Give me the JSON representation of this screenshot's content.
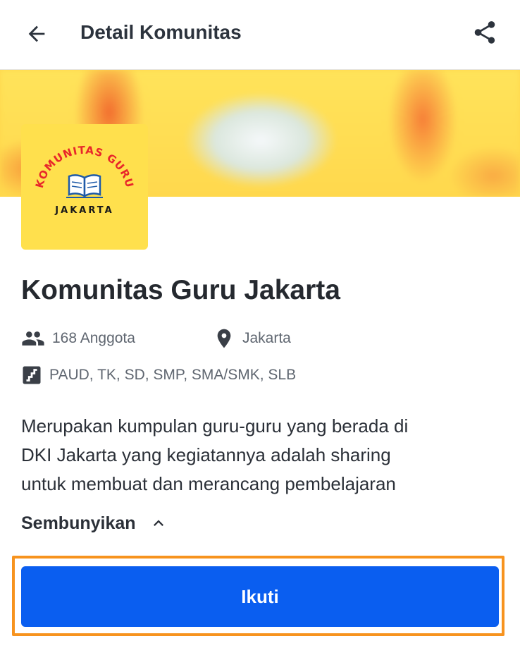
{
  "appbar": {
    "title": "Detail Komunitas",
    "back_icon": "arrow-left-icon",
    "share_icon": "share-icon"
  },
  "banner": {
    "description": "blurred community banner"
  },
  "logo": {
    "arc_text": "KOMUNITAS GURU",
    "bottom_text": "JAKARTA",
    "icon": "book-icon",
    "arc_color": "#e8262a"
  },
  "community": {
    "name": "Komunitas Guru Jakarta",
    "members": "168 Anggota",
    "location": "Jakarta",
    "levels": "PAUD, TK, SD, SMP, SMA/SMK, SLB",
    "members_icon": "people-icon",
    "location_icon": "location-pin-icon",
    "levels_icon": "stairs-icon",
    "description_lines": [
      "Merupakan kumpulan guru-guru yang berada di",
      "DKI Jakarta yang kegiatannya adalah sharing",
      "untuk membuat dan merancang pembelajaran"
    ]
  },
  "toggle": {
    "label": "Sembunyikan",
    "icon": "chevron-up-icon"
  },
  "follow_button": {
    "label": "Ikuti",
    "color": "#0a5ef0",
    "highlight_color": "#f7931e"
  }
}
